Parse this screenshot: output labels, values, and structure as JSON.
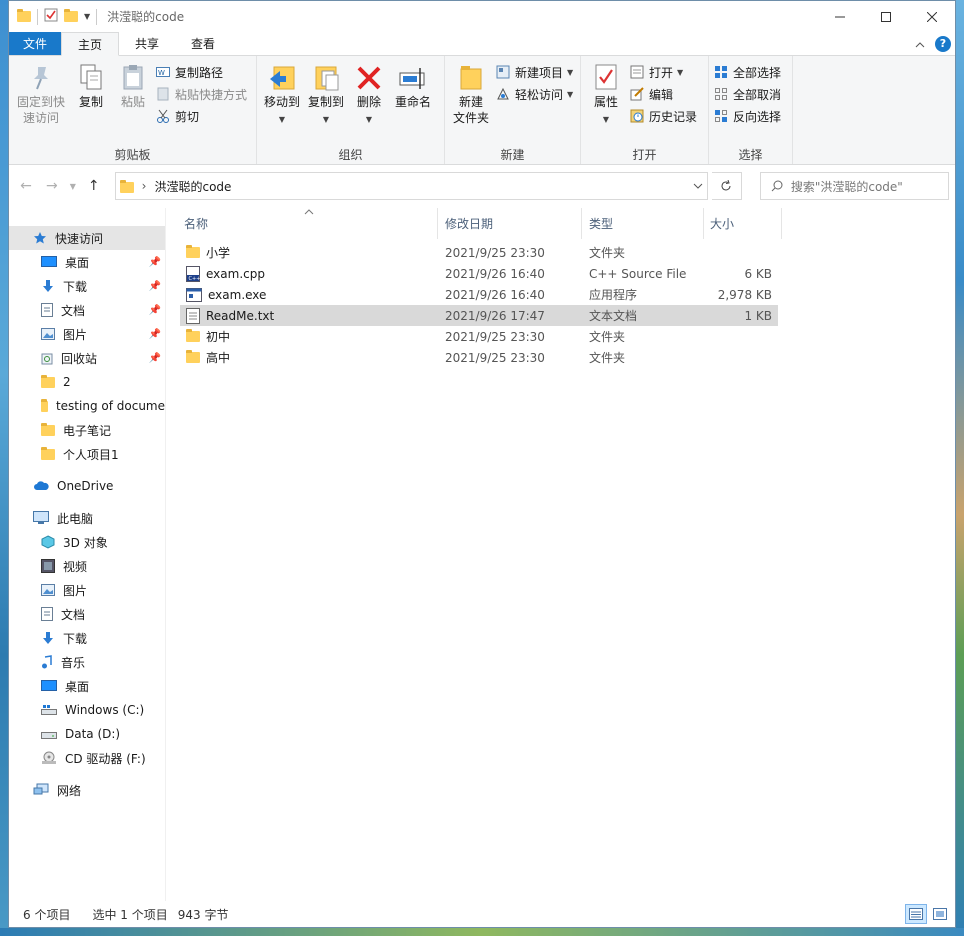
{
  "window": {
    "title": "洪滢聪的code"
  },
  "menu_tabs": [
    {
      "label": "文件"
    },
    {
      "label": "主页"
    },
    {
      "label": "共享"
    },
    {
      "label": "查看"
    }
  ],
  "ribbon": {
    "clipboard": {
      "pin_label": "固定到快\n速访问",
      "copy_label": "复制",
      "paste_label": "粘贴",
      "copy_path_label": "复制路径",
      "paste_shortcut_label": "粘贴快捷方式",
      "cut_label": "剪切",
      "group_label": "剪贴板"
    },
    "organize": {
      "move_to_label": "移动到",
      "copy_to_label": "复制到",
      "delete_label": "删除",
      "rename_label": "重命名",
      "group_label": "组织"
    },
    "new": {
      "new_folder_label": "新建\n文件夹",
      "new_item_label": "新建项目",
      "easy_access_label": "轻松访问",
      "group_label": "新建"
    },
    "open": {
      "properties_label": "属性",
      "open_label": "打开",
      "edit_label": "编辑",
      "history_label": "历史记录",
      "group_label": "打开"
    },
    "select": {
      "select_all_label": "全部选择",
      "select_none_label": "全部取消",
      "invert_label": "反向选择",
      "group_label": "选择"
    }
  },
  "address": {
    "path": "洪滢聪的code",
    "search_placeholder": "搜索\"洪滢聪的code\""
  },
  "nav": {
    "quick_access": "快速访问",
    "pinned": [
      "桌面",
      "下载",
      "文档",
      "图片",
      "回收站"
    ],
    "folders": [
      "2",
      "testing of docume",
      "电子笔记",
      "个人项目1"
    ],
    "onedrive": "OneDrive",
    "this_pc": "此电脑",
    "pc_items": [
      "3D 对象",
      "视频",
      "图片",
      "文档",
      "下载",
      "音乐",
      "桌面",
      "Windows (C:)",
      "Data (D:)",
      "CD 驱动器 (F:)"
    ],
    "network": "网络"
  },
  "columns": {
    "name": "名称",
    "date": "修改日期",
    "type": "类型",
    "size": "大小"
  },
  "files": [
    {
      "name": "小学",
      "date": "2021/9/25 23:30",
      "type": "文件夹",
      "size": "",
      "icon": "folder-icon"
    },
    {
      "name": "exam.cpp",
      "date": "2021/9/26 16:40",
      "type": "C++ Source File",
      "size": "6 KB",
      "icon": "cpp-file-icon"
    },
    {
      "name": "exam.exe",
      "date": "2021/9/26 16:40",
      "type": "应用程序",
      "size": "2,978 KB",
      "icon": "exe-file-icon"
    },
    {
      "name": "ReadMe.txt",
      "date": "2021/9/26 17:47",
      "type": "文本文档",
      "size": "1 KB",
      "icon": "text-file-icon",
      "selected": true
    },
    {
      "name": "初中",
      "date": "2021/9/25 23:30",
      "type": "文件夹",
      "size": "",
      "icon": "folder-icon"
    },
    {
      "name": "高中",
      "date": "2021/9/25 23:30",
      "type": "文件夹",
      "size": "",
      "icon": "folder-icon"
    }
  ],
  "status": {
    "item_count": "6 个项目",
    "selection": "选中 1 个项目",
    "size": "943 字节"
  },
  "colors": {
    "accent": "#1979ca",
    "folder": "#ffd15c",
    "selection_bg": "#d9d9d9",
    "ribbon_bg": "#f5f6f7"
  }
}
